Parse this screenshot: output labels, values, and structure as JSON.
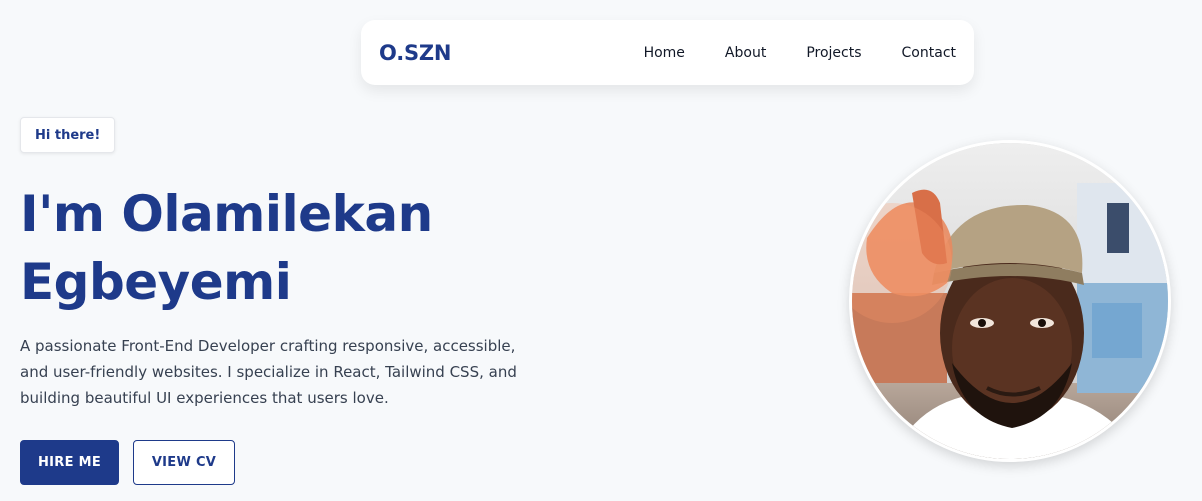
{
  "navbar": {
    "brand": "O.SZN",
    "links": [
      "Home",
      "About",
      "Projects",
      "Contact"
    ]
  },
  "hero": {
    "greeting": "Hi there!",
    "title_line1": "I'm Olamilekan",
    "title_line2": "Egbeyemi",
    "description": "A passionate Front-End Developer crafting responsive, accessible, and user-friendly websites. I specialize in React, Tailwind CSS, and building beautiful UI experiences that users love.",
    "primary_button": "HIRE ME",
    "secondary_button": "VIEW CV"
  },
  "colors": {
    "accent": "#1e3a8a",
    "background": "#f7f9fb"
  }
}
